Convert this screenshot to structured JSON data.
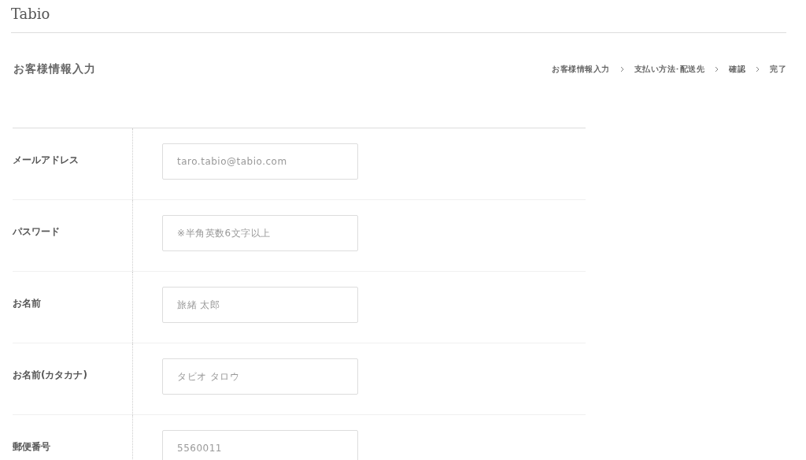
{
  "logo": "Tabio",
  "page_title": "お客様情報入力",
  "steps": [
    "お客様情報入力",
    "支払い方法･配送先",
    "確認",
    "完了"
  ],
  "fields": [
    {
      "label": "メールアドレス",
      "placeholder": "taro.tabio@tabio.com"
    },
    {
      "label": "パスワード",
      "placeholder": "※半角英数6文字以上"
    },
    {
      "label": "お名前",
      "placeholder": "旅緒 太郎"
    },
    {
      "label": "お名前(カタカナ)",
      "placeholder": "タビオ タロウ"
    },
    {
      "label": "郵便番号",
      "placeholder": "5560011"
    }
  ]
}
